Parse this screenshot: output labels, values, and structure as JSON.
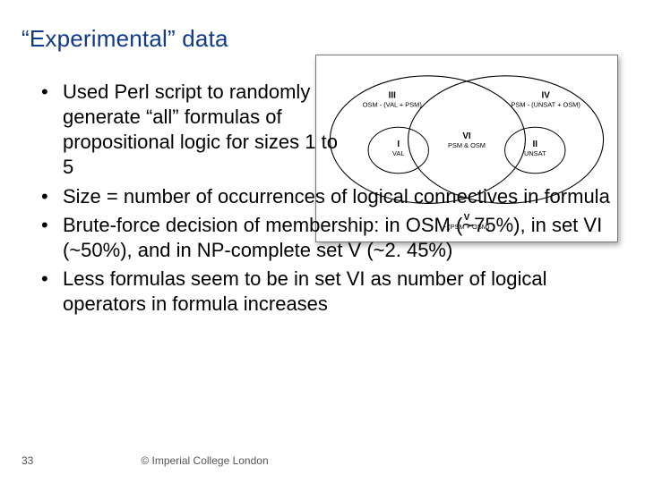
{
  "title": "“Experimental” data",
  "bullets": [
    "Used Perl script to randomly generate “all” formulas of propositional logic for sizes 1 to 5",
    "Size = number of occurrences of logical connectives in formula",
    "Brute-force decision of membership: in OSM (~75%), in set VI (~50%), and in NP-complete set V (~2. 45%)",
    "Less formulas seem to be in set VI as number of logical operators in formula increases"
  ],
  "diagram": {
    "regions": {
      "III": {
        "roman": "III",
        "desc": "OSM - (VAL + PSM)"
      },
      "I": {
        "roman": "I",
        "desc": "VAL"
      },
      "VI": {
        "roman": "VI",
        "desc": "PSM & OSM"
      },
      "II": {
        "roman": "II",
        "desc": "UNSAT"
      },
      "IV": {
        "roman": "IV",
        "desc": "PSM - (UNSAT + OSM)"
      },
      "V": {
        "roman": "V",
        "desc": "- (PSM + OSM)"
      }
    }
  },
  "footer": {
    "page": "33",
    "copyright": "© Imperial College London"
  }
}
